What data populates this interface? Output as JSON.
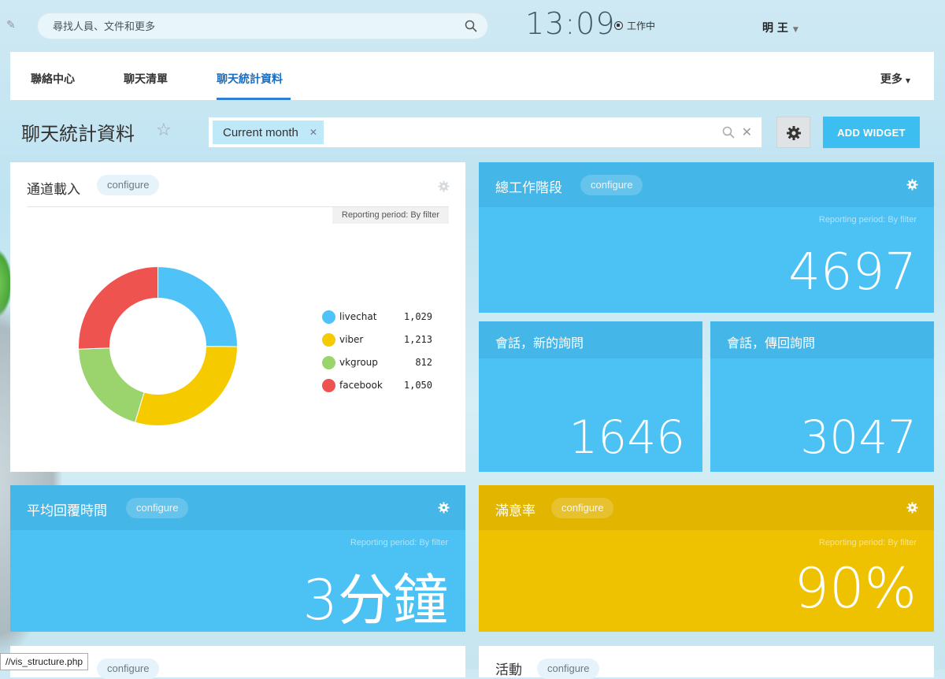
{
  "search": {
    "placeholder": "尋找人員、文件和更多"
  },
  "clock": "13:09",
  "status": "工作中",
  "user": "明 王",
  "nav": {
    "tabs": [
      "聯絡中心",
      "聊天清單",
      "聊天統計資料"
    ],
    "active_index": 2,
    "more": "更多"
  },
  "page": {
    "title": "聊天統計資料",
    "filter_chip": "Current month",
    "add_widget": "ADD WIDGET"
  },
  "widgets": {
    "channel_load": {
      "title": "通道載入",
      "configure": "configure",
      "period": "Reporting period: By filter",
      "legend": [
        {
          "name": "livechat",
          "value": "1,029",
          "color": "#4fc3f7"
        },
        {
          "name": "viber",
          "value": "1,213",
          "color": "#f5cb00"
        },
        {
          "name": "vkgroup",
          "value": "812",
          "color": "#9bd46c"
        },
        {
          "name": "facebook",
          "value": "1,050",
          "color": "#ef5350"
        }
      ]
    },
    "total_sessions": {
      "title": "總工作階段",
      "configure": "configure",
      "period": "Reporting period: By filter",
      "value": "4697"
    },
    "new_inquiries": {
      "title": "會話，新的詢問",
      "value": "1646"
    },
    "returning_inquiries": {
      "title": "會話，傳回詢問",
      "value": "3047"
    },
    "avg_response": {
      "title": "平均回覆時間",
      "configure": "configure",
      "period": "Reporting period: By filter",
      "value": "3分鐘"
    },
    "satisfaction": {
      "title": "滿意率",
      "configure": "configure",
      "period": "Reporting period: By filter",
      "value": "90%"
    },
    "bottom_left": {
      "configure": "configure"
    },
    "activity": {
      "title": "活動",
      "configure": "configure"
    }
  },
  "chart_data": {
    "type": "pie",
    "categories": [
      "livechat",
      "viber",
      "vkgroup",
      "facebook"
    ],
    "values": [
      1029,
      1213,
      812,
      1050
    ]
  },
  "tooltip": "//vis_structure.php",
  "colors": {
    "accent_blue": "#4cc2f4",
    "accent_yellow": "#eec200",
    "active_tab": "#1a6fc0"
  }
}
